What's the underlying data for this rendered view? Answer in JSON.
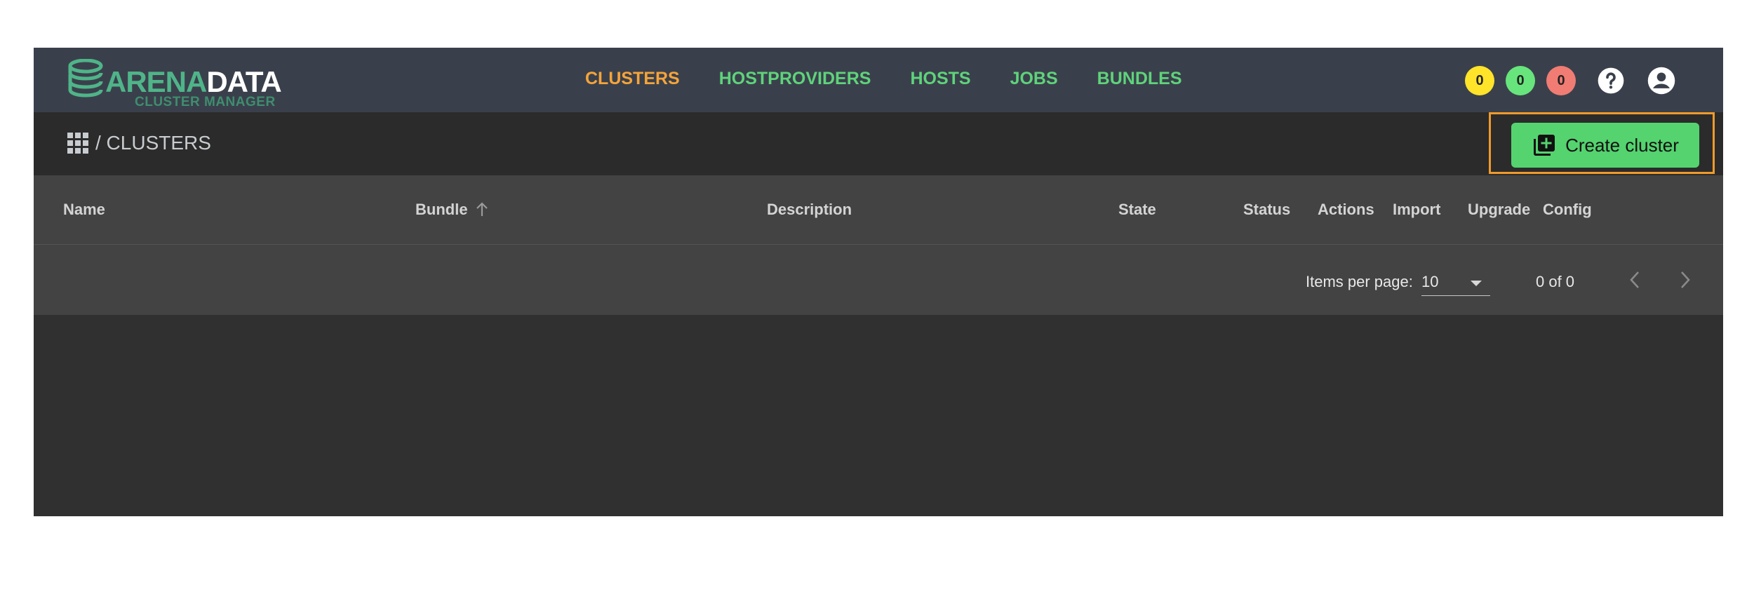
{
  "logo": {
    "word_left": "ARENA",
    "word_right": "DATA",
    "subtitle": "CLUSTER MANAGER"
  },
  "nav": {
    "items": [
      {
        "label": "CLUSTERS",
        "active": true
      },
      {
        "label": "HOSTPROVIDERS",
        "active": false
      },
      {
        "label": "HOSTS",
        "active": false
      },
      {
        "label": "JOBS",
        "active": false
      },
      {
        "label": "BUNDLES",
        "active": false
      }
    ]
  },
  "status_badges": [
    {
      "value": "0",
      "color": "#ffe42a"
    },
    {
      "value": "0",
      "color": "#67e57c"
    },
    {
      "value": "0",
      "color": "#f07c74"
    }
  ],
  "icons": {
    "help": "help-icon",
    "account": "account-icon",
    "apps": "apps-grid-icon",
    "library_add": "library-add-icon"
  },
  "breadcrumb": {
    "text": "/ CLUSTERS"
  },
  "toolbar": {
    "create_label": "Create cluster"
  },
  "table": {
    "columns": [
      "Name",
      "Bundle",
      "Description",
      "State",
      "Status",
      "Actions",
      "Import",
      "Upgrade",
      "Config"
    ],
    "sorted_column": "Bundle",
    "sort_direction": "ascending",
    "rows": []
  },
  "pagination": {
    "items_per_page_label": "Items per page:",
    "items_per_page_value": "10",
    "range_label": "0 of 0"
  },
  "colors": {
    "nav_active": "#f5a43a",
    "nav_default": "#5fd37b",
    "primary_button": "#54d36f",
    "highlight_border": "#f09a2b",
    "topbar_bg": "#3a404b"
  }
}
